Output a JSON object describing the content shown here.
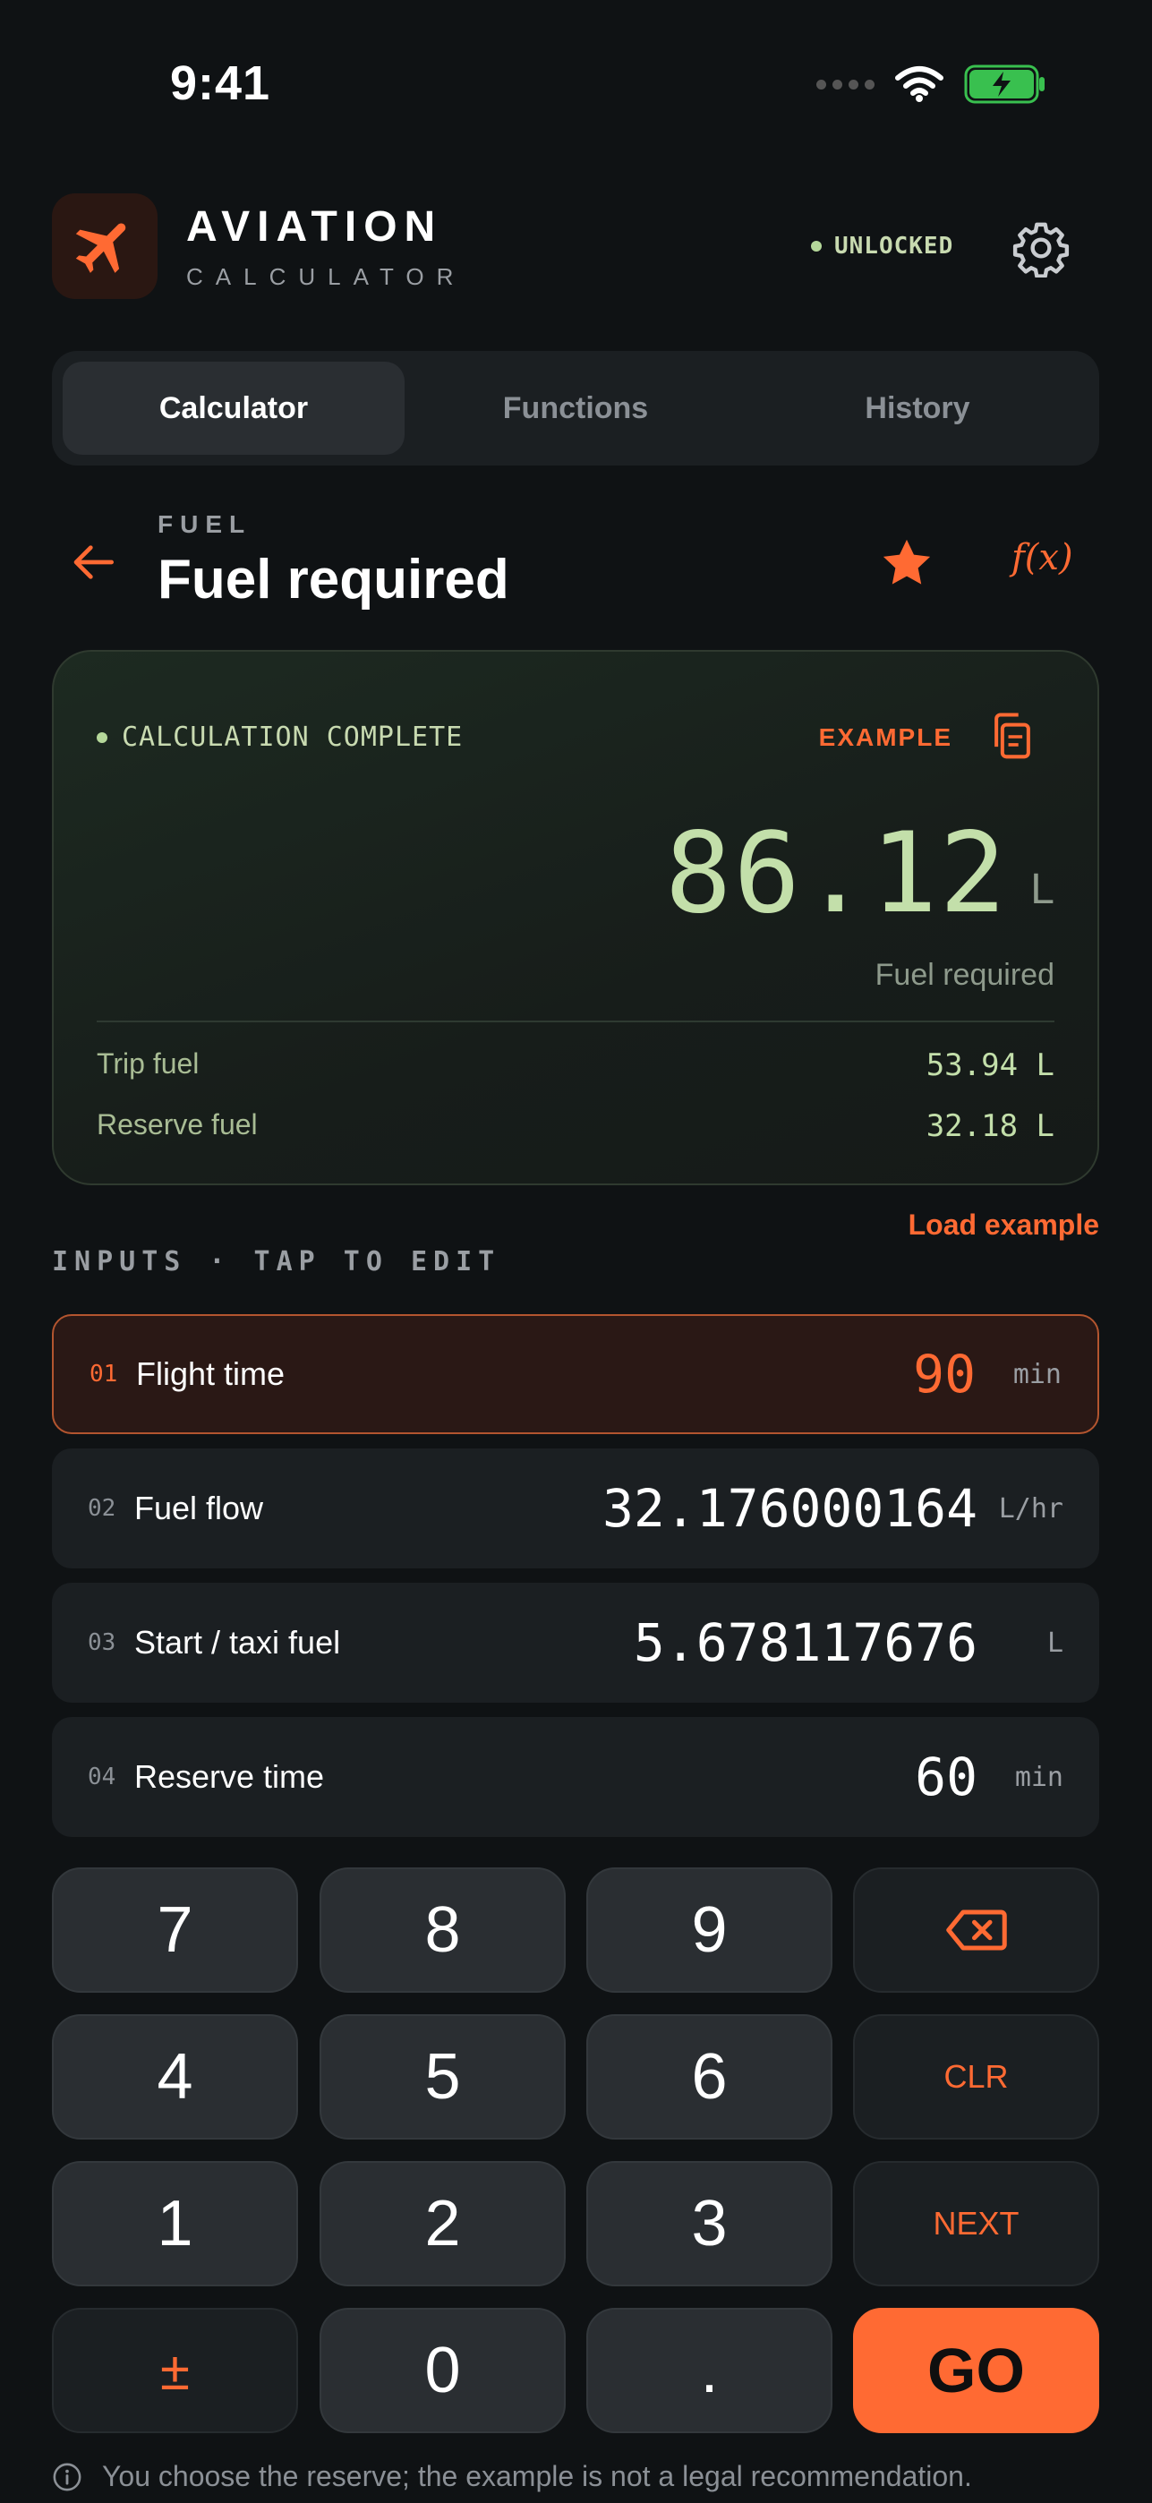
{
  "status_bar": {
    "time": "9:41"
  },
  "header": {
    "title": "AVIATION",
    "subtitle": "CALCULATOR",
    "unlock_status": "UNLOCKED",
    "accent_color": "#ff6a33"
  },
  "tabs": [
    {
      "label": "Calculator",
      "active": true
    },
    {
      "label": "Functions",
      "active": false
    },
    {
      "label": "History",
      "active": false
    }
  ],
  "page": {
    "category": "FUEL",
    "title": "Fuel required",
    "fx_label": "f(x)"
  },
  "result": {
    "status": "CALCULATION COMPLETE",
    "example_label": "EXAMPLE",
    "value": "86.12",
    "unit": "L",
    "label": "Fuel required",
    "breakdown": [
      {
        "label": "Trip fuel",
        "value": "53.94 L"
      },
      {
        "label": "Reserve fuel",
        "value": "32.18 L"
      }
    ]
  },
  "load_example": "Load example",
  "inputs_label": "INPUTS · TAP TO EDIT",
  "inputs": [
    {
      "num": "01",
      "name": "Flight time",
      "value": "90",
      "unit": "min",
      "active": true
    },
    {
      "num": "02",
      "name": "Fuel flow",
      "value": "32.176000164",
      "unit": "L/hr",
      "active": false
    },
    {
      "num": "03",
      "name": "Start / taxi fuel",
      "value": "5.678117676",
      "unit": "L",
      "active": false
    },
    {
      "num": "04",
      "name": "Reserve time",
      "value": "60",
      "unit": "min",
      "active": false
    }
  ],
  "keypad": {
    "k7": "7",
    "k8": "8",
    "k9": "9",
    "k4": "4",
    "k5": "5",
    "k6": "6",
    "clr": "CLR",
    "k1": "1",
    "k2": "2",
    "k3": "3",
    "next": "NEXT",
    "pm": "±",
    "k0": "0",
    "dot": ".",
    "go": "GO"
  },
  "footnote": "You choose the reserve; the example is not a legal recommendation."
}
